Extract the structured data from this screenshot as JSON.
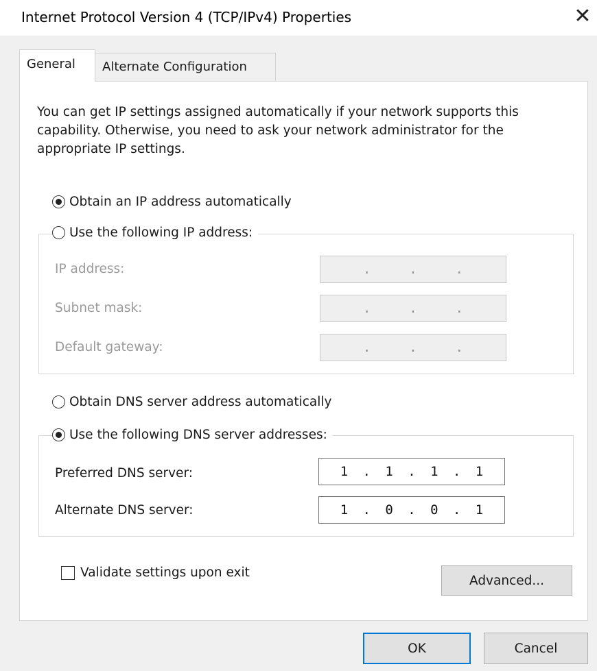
{
  "window": {
    "title": "Internet Protocol Version 4 (TCP/IPv4) Properties",
    "close_glyph": "✕"
  },
  "tabs": [
    {
      "label": "General",
      "selected": true
    },
    {
      "label": "Alternate Configuration",
      "selected": false
    }
  ],
  "description": "You can get IP settings assigned automatically if your network supports this capability. Otherwise, you need to ask your network administrator for the appropriate IP settings.",
  "ip": {
    "obtain_auto_label": "Obtain an IP address automatically",
    "obtain_auto_selected": true,
    "use_following_label": "Use the following IP address:",
    "use_following_selected": false,
    "fields": [
      {
        "label": "IP address:",
        "octets": [
          "",
          "",
          "",
          ""
        ],
        "enabled": false
      },
      {
        "label": "Subnet mask:",
        "octets": [
          "",
          "",
          "",
          ""
        ],
        "enabled": false
      },
      {
        "label": "Default gateway:",
        "octets": [
          "",
          "",
          "",
          ""
        ],
        "enabled": false
      }
    ]
  },
  "dns": {
    "obtain_auto_label": "Obtain DNS server address automatically",
    "obtain_auto_selected": false,
    "use_following_label": "Use the following DNS server addresses:",
    "use_following_selected": true,
    "fields": [
      {
        "label": "Preferred DNS server:",
        "octets": [
          "1",
          "1",
          "1",
          "1"
        ],
        "enabled": true
      },
      {
        "label": "Alternate DNS server:",
        "octets": [
          "1",
          "0",
          "0",
          "1"
        ],
        "enabled": true
      }
    ]
  },
  "validate": {
    "label": "Validate settings upon exit",
    "checked": false
  },
  "buttons": {
    "advanced": "Advanced...",
    "ok": "OK",
    "cancel": "Cancel"
  },
  "colors": {
    "default_button_border": "#0078d7",
    "dialog_background": "#f0f0f0"
  }
}
